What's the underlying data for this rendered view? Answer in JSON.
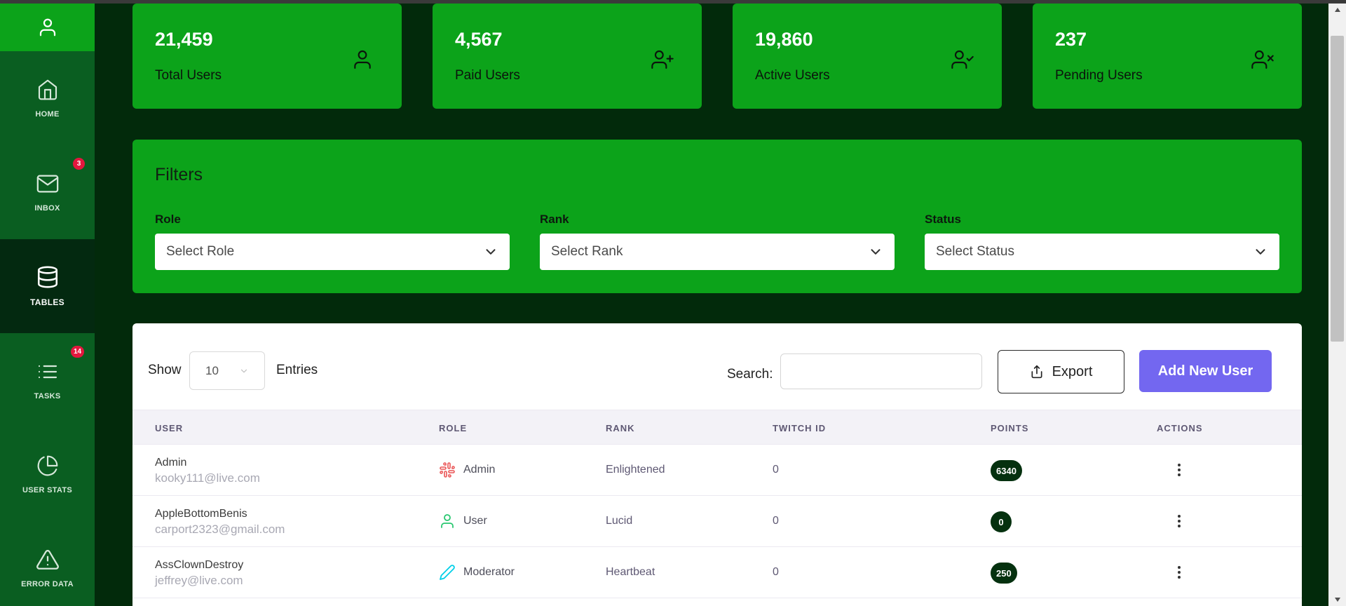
{
  "sidebar": {
    "items": [
      {
        "label": "HOME",
        "icon": "home-icon"
      },
      {
        "label": "INBOX",
        "icon": "mail-icon",
        "badge": "3"
      },
      {
        "label": "TABLES",
        "icon": "database-icon",
        "active": true
      },
      {
        "label": "TASKS",
        "icon": "list-icon",
        "badge": "14"
      },
      {
        "label": "USER STATS",
        "icon": "pie-chart-icon"
      },
      {
        "label": "ERROR DATA",
        "icon": "alert-triangle-icon"
      }
    ]
  },
  "stats": [
    {
      "value": "21,459",
      "label": "Total Users",
      "icon": "user-icon"
    },
    {
      "value": "4,567",
      "label": "Paid Users",
      "icon": "user-plus-icon"
    },
    {
      "value": "19,860",
      "label": "Active Users",
      "icon": "user-check-icon"
    },
    {
      "value": "237",
      "label": "Pending Users",
      "icon": "user-x-icon"
    }
  ],
  "filters": {
    "title": "Filters",
    "role": {
      "label": "Role",
      "value": "Select Role"
    },
    "rank": {
      "label": "Rank",
      "value": "Select Rank"
    },
    "status": {
      "label": "Status",
      "value": "Select Status"
    }
  },
  "table": {
    "show_label": "Show",
    "show_value": "10",
    "entries_label": "Entries",
    "search_label": "Search:",
    "search_value": "",
    "export_label": "Export",
    "add_label": "Add New User",
    "columns": [
      "USER",
      "ROLE",
      "RANK",
      "TWITCH ID",
      "POINTS",
      "ACTIONS"
    ],
    "rows": [
      {
        "name": "Admin",
        "email": "kooky111@live.com",
        "role": "Admin",
        "role_icon": "slack-icon",
        "rank": "Enlightened",
        "twitch_id": "0",
        "points": "6340"
      },
      {
        "name": "AppleBottomBenis",
        "email": "carport2323@gmail.com",
        "role": "User",
        "role_icon": "user-icon",
        "rank": "Lucid",
        "twitch_id": "0",
        "points": "0"
      },
      {
        "name": "AssClownDestroy",
        "email": "jeffrey@live.com",
        "role": "Moderator",
        "role_icon": "pencil-icon",
        "rank": "Heartbeat",
        "twitch_id": "0",
        "points": "250"
      }
    ]
  },
  "colors": {
    "sidebar_bg": "#0a5e21",
    "active_bg": "#032910",
    "card_green": "#0ca31a",
    "page_bg": "#022a0b",
    "primary": "#7367f0",
    "badge_red": "#e3173e"
  }
}
